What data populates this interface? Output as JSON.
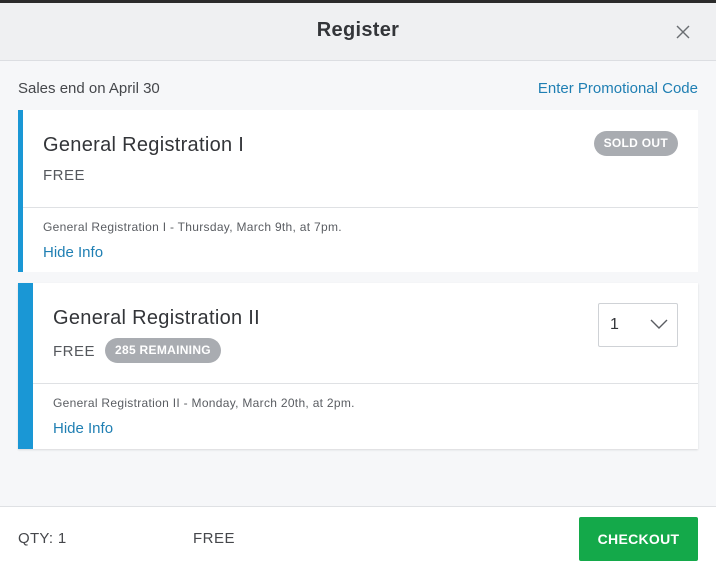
{
  "header": {
    "title": "Register",
    "close_icon": "close-icon"
  },
  "info_bar": {
    "sales_end": "Sales end on April 30",
    "promo_link": "Enter Promotional Code"
  },
  "tickets": [
    {
      "name": "General Registration I",
      "price": "FREE",
      "badge": "SOLD OUT",
      "description": "General Registration I - Thursday, March 9th, at 7pm.",
      "info_link": "Hide Info"
    },
    {
      "name": "General Registration II",
      "price": "FREE",
      "badge": "285 REMAINING",
      "quantity": "1",
      "description": "General Registration II - Monday, March 20th, at 2pm.",
      "info_link": "Hide Info"
    }
  ],
  "footer": {
    "qty": "QTY: 1",
    "total": "FREE",
    "checkout": "CHECKOUT"
  },
  "colors": {
    "accent_blue": "#1a97d5",
    "link_blue": "#1f7fb3",
    "checkout_green": "#14a94a",
    "badge_gray": "#a9acb1"
  }
}
